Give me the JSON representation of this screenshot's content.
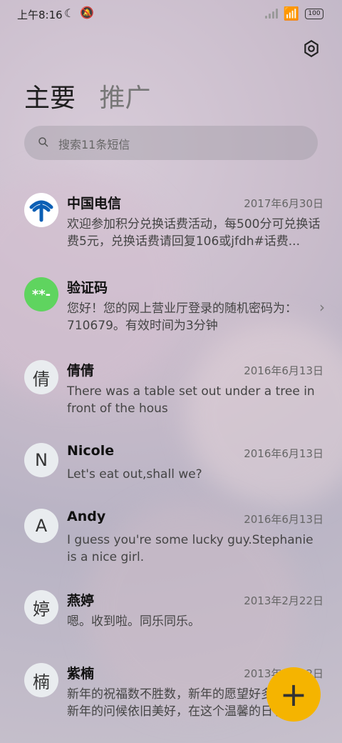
{
  "status": {
    "time": "上午8:16",
    "battery": "100"
  },
  "header": {
    "tabs": [
      "主要",
      "推广"
    ]
  },
  "search": {
    "placeholder": "搜索11条短信"
  },
  "messages": [
    {
      "sender": "中国电信",
      "date": "2017年6月30日",
      "snippet": "欢迎参加积分兑换话费活动，每500分可兑换话费5元，兑换话费请回复106或jfdh#话费...",
      "avatar": "telecom-logo"
    },
    {
      "sender": "验证码",
      "date": "",
      "snippet": "您好！您的网上营业厅登录的随机密码为：710679。有效时间为3分钟",
      "avatar": "**-"
    },
    {
      "sender": "倩倩",
      "date": "2016年6月13日",
      "snippet": "There was a table set out under a tree in front of the hous",
      "avatar": "倩"
    },
    {
      "sender": "Nicole",
      "date": "2016年6月13日",
      "snippet": "Let's eat out,shall we?",
      "avatar": "N"
    },
    {
      "sender": "Andy",
      "date": "2016年6月13日",
      "snippet": "I guess you're some lucky guy.Stephanie is a nice girl.",
      "avatar": "A"
    },
    {
      "sender": "燕婷",
      "date": "2013年2月22日",
      "snippet": "嗯。收到啦。同乐同乐。",
      "avatar": "婷"
    },
    {
      "sender": "紫楠",
      "date": "2013年2月22日",
      "snippet": "新年的祝福数不胜数，新年的愿望好多好多，新年的问候依旧美好，在这个温馨的日子里",
      "avatar": "楠"
    }
  ],
  "fab": {
    "label": "+"
  },
  "colors": {
    "fab": "#f5b400",
    "verification_avatar": "#5fd45f",
    "telecom_blue": "#0b5fb5"
  }
}
